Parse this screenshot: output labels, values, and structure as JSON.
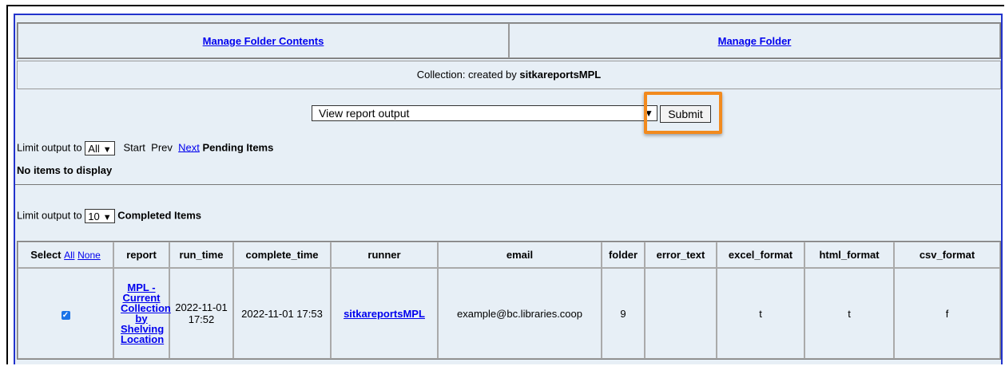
{
  "nav": {
    "manage_contents": "Manage Folder Contents",
    "manage_folder": "Manage Folder"
  },
  "collection": {
    "prefix": "Collection: created by ",
    "owner": "sitkareportsMPL"
  },
  "actions": {
    "selected": "View report output",
    "submit": "Submit"
  },
  "pending": {
    "limit_label": "Limit output to",
    "limit_value": "All",
    "start": "Start",
    "prev": "Prev",
    "next": "Next",
    "title": "Pending Items",
    "empty": "No items to display"
  },
  "completed": {
    "limit_label": "Limit output to",
    "limit_value": "10",
    "title": "Completed Items"
  },
  "table": {
    "headers": {
      "select": "Select",
      "all": "All",
      "none": "None",
      "report": "report",
      "run_time": "run_time",
      "complete_time": "complete_time",
      "runner": "runner",
      "email": "email",
      "folder": "folder",
      "error_text": "error_text",
      "excel_format": "excel_format",
      "html_format": "html_format",
      "csv_format": "csv_format"
    },
    "rows": [
      {
        "checked": true,
        "report": "MPL - Current Collection by Shelving Location",
        "run_time": "2022-11-01 17:52",
        "complete_time": "2022-11-01 17:53",
        "runner": "sitkareportsMPL",
        "email": "example@bc.libraries.coop",
        "folder": "9",
        "error_text": "",
        "excel_format": "t",
        "html_format": "t",
        "csv_format": "f"
      }
    ]
  },
  "colors": {
    "panel_bg": "#e7eff6",
    "link": "#0000ee",
    "highlight": "#f28a1e",
    "frame_blue": "#2233cc"
  }
}
